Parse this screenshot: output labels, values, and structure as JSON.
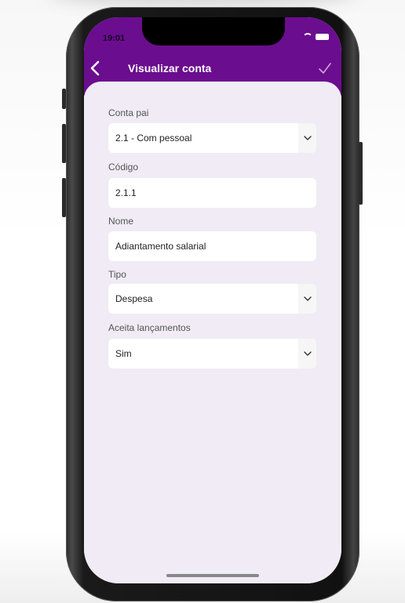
{
  "status_bar": {
    "time": "19:01"
  },
  "header": {
    "title": "Visualizar conta",
    "back_icon": "chevron-left-icon",
    "confirm_icon": "checkmark-icon",
    "color": "#6b0d8f"
  },
  "form": {
    "parent_account": {
      "label": "Conta pai",
      "value": "2.1 - Com pessoal"
    },
    "code": {
      "label": "Código",
      "value": "2.1.1"
    },
    "name": {
      "label": "Nome",
      "value": "Adiantamento salarial"
    },
    "type": {
      "label": "Tipo",
      "value": "Despesa"
    },
    "accepts_entries": {
      "label": "Aceita lançamentos",
      "value": "Sim"
    }
  },
  "colors": {
    "background": "#f0ebf4",
    "field": "#ffffff",
    "label": "#555555"
  }
}
